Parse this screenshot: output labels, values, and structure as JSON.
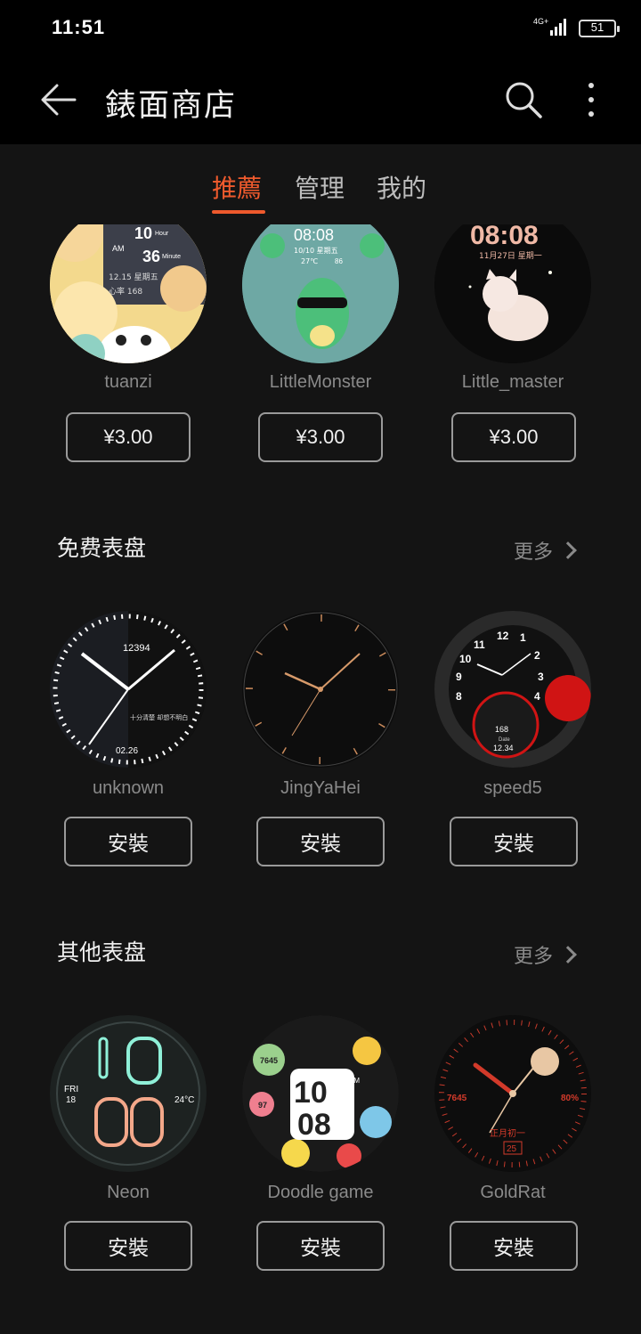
{
  "status": {
    "time": "11:51",
    "network": "4G+",
    "battery": "51"
  },
  "app": {
    "title": "錶面商店"
  },
  "tabs": [
    {
      "label": "推薦",
      "active": true
    },
    {
      "label": "管理",
      "active": false
    },
    {
      "label": "我的",
      "active": false
    }
  ],
  "featured": [
    {
      "name": "tuanzi",
      "price": "¥3.00",
      "face_text": [
        "10",
        "Hour",
        "36",
        "Minute",
        "AM",
        "12.15 星期五",
        "心率 168"
      ]
    },
    {
      "name": "LittleMonster",
      "price": "¥3.00",
      "face_text": [
        "08:08",
        "10/10 星期五",
        "27℃",
        "86"
      ]
    },
    {
      "name": "Little_master",
      "price": "¥3.00",
      "face_text": [
        "08:08",
        "11月27日 星期一"
      ]
    }
  ],
  "free_section": {
    "title": "免费表盘",
    "more": "更多",
    "items": [
      {
        "name": "unknown",
        "button": "安裝",
        "face_text": [
          "12394",
          "十分清楚 却想不明白",
          "02.26"
        ]
      },
      {
        "name": "JingYaHei",
        "button": "安裝",
        "face_text": []
      },
      {
        "name": "speed5",
        "button": "安裝",
        "face_text": [
          "11",
          "12",
          "1",
          "2",
          "3",
          "4",
          "8",
          "9",
          "10",
          "168",
          "Date",
          "12.34"
        ]
      }
    ]
  },
  "other_section": {
    "title": "其他表盘",
    "more": "更多",
    "items": [
      {
        "name": "Neon",
        "button": "安裝",
        "face_text": [
          "FRI",
          "18",
          "24°C"
        ]
      },
      {
        "name": "Doodle game",
        "button": "安裝",
        "face_text": [
          "7645",
          "97",
          "10",
          "08",
          "AM"
        ]
      },
      {
        "name": "GoldRat",
        "button": "安裝",
        "face_text": [
          "7645",
          "80%",
          "正月初一",
          "25"
        ]
      }
    ]
  },
  "colors": {
    "accent": "#ee5a2d",
    "background": "#141414",
    "bar": "#000000"
  }
}
